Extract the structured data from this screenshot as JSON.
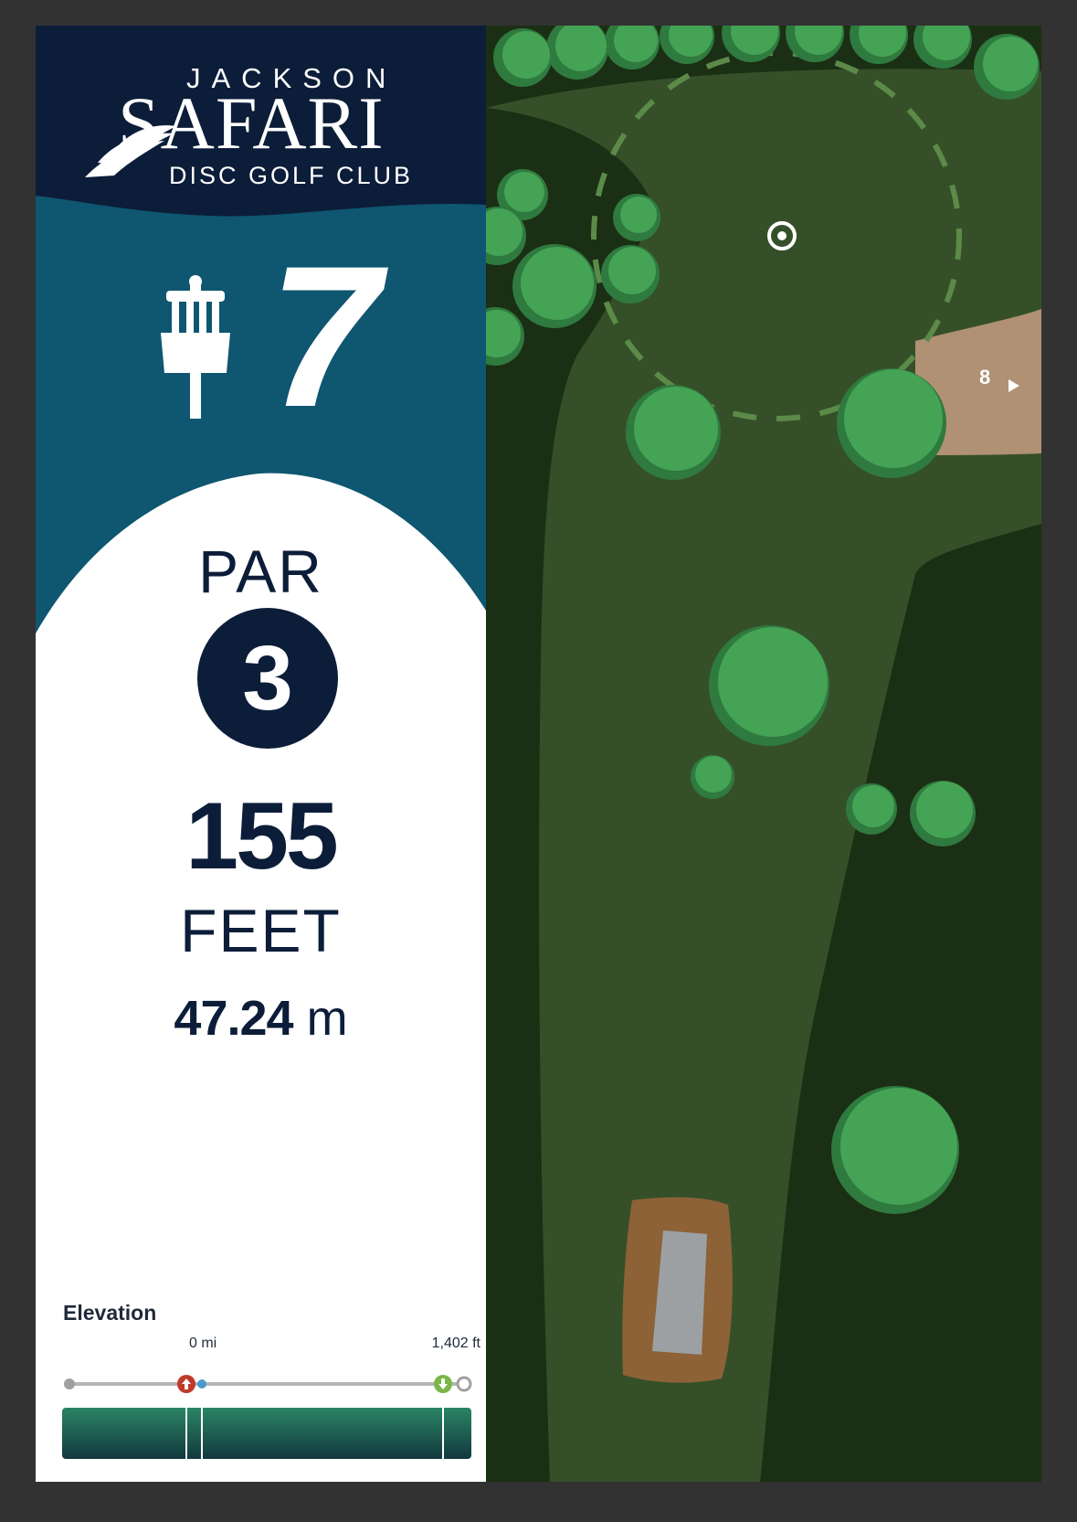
{
  "brand": {
    "top_word": "JACKSON",
    "main_word": "SAFARI",
    "subtitle": "DISC GOLF CLUB"
  },
  "hole": {
    "number": "7",
    "icon": "disc-golf-basket-icon",
    "par_label": "PAR",
    "par_value": "3",
    "distance_feet": "155",
    "distance_feet_unit": "FEET",
    "distance_meters": "47.24",
    "distance_meters_unit": "m"
  },
  "elevation": {
    "title": "Elevation",
    "start_label": "0 mi",
    "end_label": "1,402 ft",
    "markers": [
      "tee-up-marker-icon",
      "basket-down-marker-icon"
    ]
  },
  "map": {
    "next_hole_label": "8",
    "next_hole_icon": "play-arrow-icon",
    "target_icon": "target-icon",
    "tee_icon": "tee-pad-icon"
  },
  "colors": {
    "navy": "#0c1d39",
    "teal": "#0f5670",
    "fairway": "#355029",
    "rough": "#1b2f14",
    "tree": "#3d9a4f",
    "tee_dirt": "#8c6236",
    "tee_pad": "#9ca0a3",
    "elev_marker_up": "#c0392b",
    "elev_marker_down": "#7ab648"
  }
}
